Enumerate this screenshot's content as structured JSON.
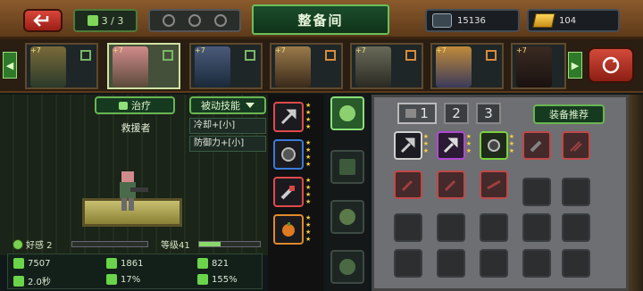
{
  "header": {
    "squad_count": "3 / 3",
    "title": "整备间",
    "currency_silver": "15136",
    "currency_gold": "104"
  },
  "hero_strip": {
    "heroes": [
      {
        "level": "+7",
        "badge": "green"
      },
      {
        "level": "+7",
        "badge": "green",
        "active": true
      },
      {
        "level": "+7",
        "badge": "green"
      },
      {
        "level": "+7",
        "badge": "orange"
      },
      {
        "level": "+7",
        "badge": "orange"
      },
      {
        "level": "+7",
        "badge": "orange"
      },
      {
        "level": "+7",
        "badge": "orange"
      }
    ]
  },
  "hero": {
    "heal_label": "治疗",
    "class_name": "救援者",
    "affinity_label": "好感 2",
    "level_label": "等级41",
    "level_progress": 0.35,
    "stats": {
      "hp": "7507",
      "attack": "1861",
      "defense": "821",
      "speed": "2.0秒",
      "crit": "17%",
      "crit_dmg": "155%"
    }
  },
  "passive": {
    "button_label": "被动技能",
    "skills": [
      "冷却+[小]",
      "防御力+[小]"
    ]
  },
  "inventory": {
    "tabs": [
      "1",
      "2",
      "3"
    ],
    "recommend_label": "装备推荐"
  },
  "colors": {
    "accent_green": "#6ab554",
    "rarity_purple": "#b04ad0",
    "rarity_red": "#d24040"
  }
}
